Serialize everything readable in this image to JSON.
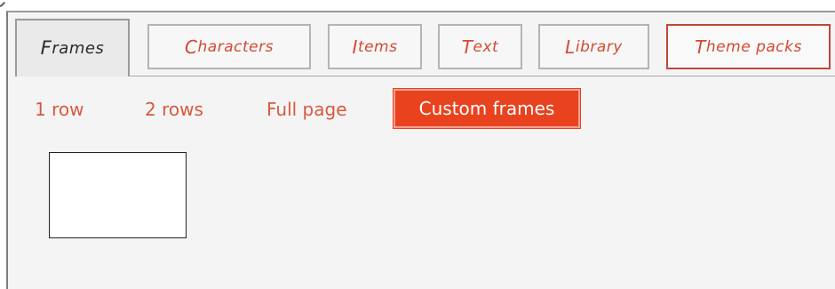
{
  "tabs": [
    {
      "first": "F",
      "rest": "rames",
      "active": true
    },
    {
      "first": "C",
      "rest": "haracters",
      "active": false
    },
    {
      "first": "I",
      "rest": "tems",
      "active": false
    },
    {
      "first": "T",
      "rest": "ext",
      "active": false
    },
    {
      "first": "L",
      "rest": "ibrary",
      "active": false
    },
    {
      "first": "T",
      "rest": "heme packs",
      "active": false
    }
  ],
  "subnav": {
    "items": [
      "1 row",
      "2 rows",
      "Full page",
      "Custom frames"
    ],
    "selected": "Custom frames"
  },
  "colors": {
    "accent": "#e8431e",
    "tab_text": "#d24a32",
    "subnav_text": "#d65a3f",
    "panel_bg": "#f4f4f4"
  }
}
